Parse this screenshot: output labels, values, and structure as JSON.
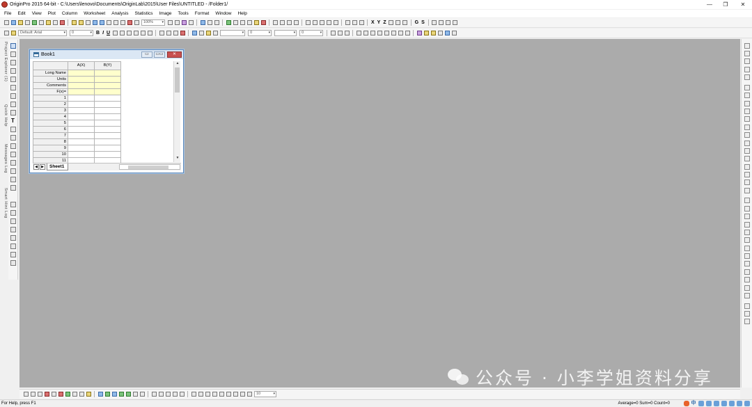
{
  "app": {
    "title": "OriginPro 2015 64-bit - C:\\Users\\lenovo\\Documents\\OriginLab\\2015\\User Files\\UNTITLED - /Folder1/",
    "window_controls": {
      "minimize": "—",
      "restore": "❐",
      "close": "✕"
    }
  },
  "menu": [
    "File",
    "Edit",
    "View",
    "Plot",
    "Column",
    "Worksheet",
    "Analysis",
    "Statistics",
    "Image",
    "Tools",
    "Format",
    "Window",
    "Help"
  ],
  "toolbar": {
    "zoom": "100%",
    "font": "Default: Arial",
    "font_size": "0",
    "bold": "B",
    "italic": "I",
    "underline": "U",
    "line_width": "0",
    "border_width": "0",
    "col_labels": [
      "X",
      "Y",
      "Z"
    ],
    "group_labels": [
      "G",
      "S"
    ],
    "bottom_combo": "10"
  },
  "left_panel_tabs": [
    "Project Explorer (1)",
    "Quick Help",
    "Messages Log",
    "Smart Hint Log"
  ],
  "left_tools_text": "T",
  "workbook": {
    "title": "Book1",
    "columns": [
      "A(X)",
      "B(Y)"
    ],
    "meta_rows": [
      "Long Name",
      "Units",
      "Comments",
      "F(x)="
    ],
    "rows": [
      "1",
      "2",
      "3",
      "4",
      "5",
      "6",
      "7",
      "8",
      "9",
      "10",
      "11"
    ],
    "sheet_tab": "Sheet1",
    "controls": {
      "minimize": "▭",
      "restore": "▭▭",
      "close": "✕"
    }
  },
  "watermark": "公众号 · 小李学姐资料分享",
  "statusbar": {
    "left": "For Help, press F1",
    "right": "Average=0 Sum=0 Count=0",
    "ime": "中"
  },
  "colors": {
    "workspace": "#ababab",
    "meta_cell": "#ffffcc",
    "accent": "#5a86b8"
  }
}
